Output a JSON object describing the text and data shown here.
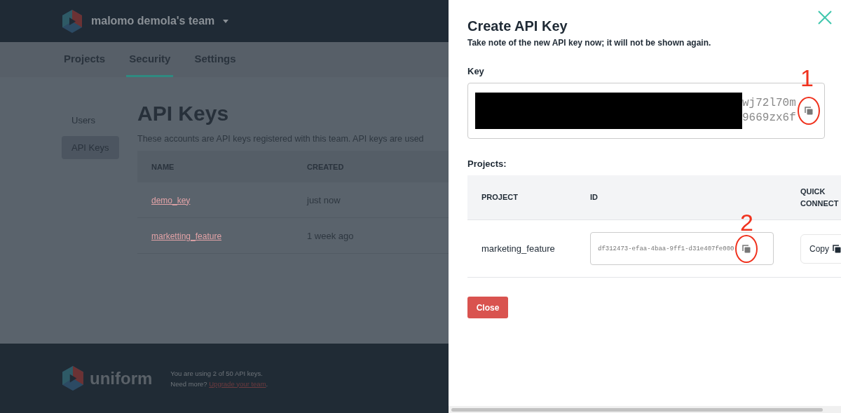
{
  "header": {
    "team_name": "malomo demola's team"
  },
  "tabs": [
    {
      "label": "Projects",
      "selected": false
    },
    {
      "label": "Security",
      "selected": true
    },
    {
      "label": "Settings",
      "selected": false
    }
  ],
  "sidebar": {
    "items": [
      {
        "label": "Users",
        "selected": false
      },
      {
        "label": "API Keys",
        "selected": true
      }
    ]
  },
  "page": {
    "title": "API Keys",
    "description": "These accounts are API keys registered with this team. API keys are used"
  },
  "keys_table": {
    "columns": [
      "NAME",
      "CREATED"
    ],
    "rows": [
      {
        "name": "demo_key",
        "created": "just now"
      },
      {
        "name": "marketting_feature",
        "created": "1 week ago"
      }
    ]
  },
  "footer": {
    "logo_text": "uniform",
    "usage": "You are using 2 of 50 API keys.",
    "prompt": "Need more?",
    "link": "Upgrade your team",
    "after": "."
  },
  "dialog": {
    "title": "Create API Key",
    "subtitle": "Take note of the new API key now; it will not be shown again.",
    "key_label": "Key",
    "key_lines": [
      "wj72l70m",
      "9669zx6f"
    ],
    "projects_label": "Projects:",
    "columns": [
      "PROJECT",
      "ID",
      "QUICK CONNECT"
    ],
    "rows": [
      {
        "project": "marketing_feature",
        "id": "df312473-efaa-4baa-9ff1-d31e407fe000",
        "copy": "Copy"
      }
    ],
    "close_button": "Close"
  },
  "annotations": [
    "1",
    "2"
  ]
}
